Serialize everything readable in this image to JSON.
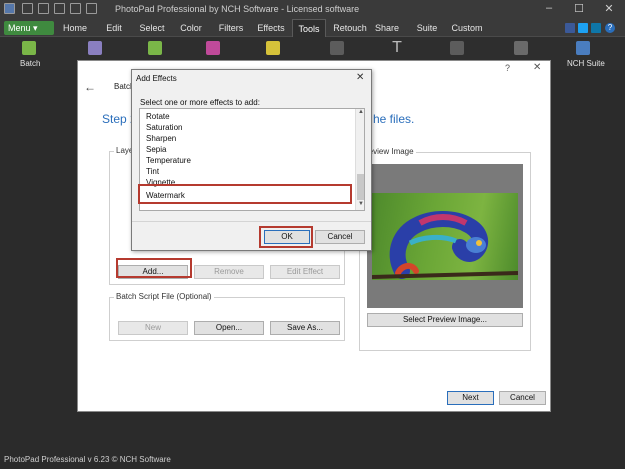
{
  "window": {
    "title": "PhotoPad Professional by NCH Software - Licensed software",
    "controls": [
      "–",
      "☐",
      "✕"
    ]
  },
  "menubar": {
    "menu_label": "Menu ▾",
    "tabs": [
      "Home",
      "Edit",
      "Select",
      "Color",
      "Filters",
      "Effects",
      "Tools",
      "Retouch",
      "Share",
      "Suite",
      "Custom"
    ],
    "active_tab": "Tools"
  },
  "toolbar": {
    "batch_label": "Batch",
    "nch_suite_label": "NCH Suite",
    "help_glyph": "?",
    "close_glyph": "✕"
  },
  "main_dialog": {
    "back_glyph": "←",
    "title_partial": "Batch",
    "step_heading_left": "Step 2:",
    "step_heading_right": "he files.",
    "layers_title": "Layer",
    "preview_title": "review Image",
    "buttons": {
      "add": "Add...",
      "remove": "Remove",
      "edit_effect": "Edit Effect",
      "new": "New",
      "open": "Open...",
      "save_as": "Save As...",
      "select_preview": "Select Preview Image...",
      "next": "Next",
      "cancel": "Cancel"
    },
    "script_section_title": "Batch Script File (Optional)"
  },
  "add_effects": {
    "title": "Add Effects",
    "close_glyph": "✕",
    "prompt": "Select one or more effects to add:",
    "items": [
      "Rotate",
      "Saturation",
      "Sharpen",
      "Sepia",
      "Temperature",
      "Tint",
      "Vignette",
      "Watermark"
    ],
    "selected": "Watermark",
    "ok_label": "OK",
    "cancel_label": "Cancel"
  },
  "statusbar": {
    "text": "PhotoPad Professional v 6.23 © NCH Software"
  },
  "colors": {
    "accent_green": "#3f8a3f",
    "highlight_red": "#b53a2f",
    "dark_bg": "#2b2b2b",
    "heading_blue": "#2a6ebb"
  }
}
